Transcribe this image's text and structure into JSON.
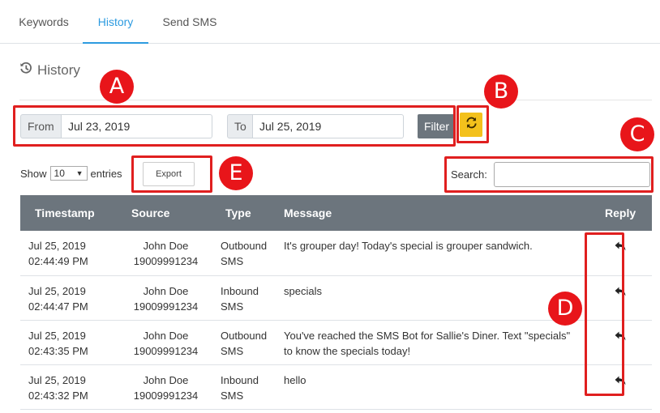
{
  "tabs": [
    {
      "label": "Keywords",
      "active": false
    },
    {
      "label": "History",
      "active": true
    },
    {
      "label": "Send SMS",
      "active": false
    }
  ],
  "page": {
    "title": "History",
    "title_icon": "history-icon"
  },
  "filter": {
    "from_label": "From",
    "from_value": "Jul 23, 2019",
    "to_label": "To",
    "to_value": "Jul 25, 2019",
    "filter_button": "Filter",
    "refresh_icon": "refresh-icon"
  },
  "controls": {
    "show_label": "Show",
    "entries_value": "10",
    "entries_label": "entries",
    "export_button": "Export",
    "search_label": "Search:",
    "search_value": ""
  },
  "table": {
    "columns": [
      "Timestamp",
      "Source",
      "Type",
      "Message",
      "Reply"
    ],
    "rows": [
      {
        "date": "Jul 25, 2019",
        "time": "02:44:49 PM",
        "name": "John Doe",
        "number": "19009991234",
        "type_a": "Outbound",
        "type_b": "SMS",
        "message": "It's grouper day! Today's special is grouper sandwich."
      },
      {
        "date": "Jul 25, 2019",
        "time": "02:44:47 PM",
        "name": "John Doe",
        "number": "19009991234",
        "type_a": "Inbound",
        "type_b": "SMS",
        "message": "specials"
      },
      {
        "date": "Jul 25, 2019",
        "time": "02:43:35 PM",
        "name": "John Doe",
        "number": "19009991234",
        "type_a": "Outbound",
        "type_b": "SMS",
        "message": "You've reached the SMS Bot for Sallie's Diner. Text \"specials\" to know the specials today!"
      },
      {
        "date": "Jul 25, 2019",
        "time": "02:43:32 PM",
        "name": "John Doe",
        "number": "19009991234",
        "type_a": "Inbound",
        "type_b": "SMS",
        "message": "hello"
      }
    ],
    "reply_icon": "reply-icon"
  },
  "callouts": [
    "A",
    "B",
    "C",
    "D",
    "E"
  ],
  "colors": {
    "accent": "#2d9be0",
    "header": "#6c757d",
    "refresh": "#f3c11c",
    "callout": "#e8151a"
  }
}
